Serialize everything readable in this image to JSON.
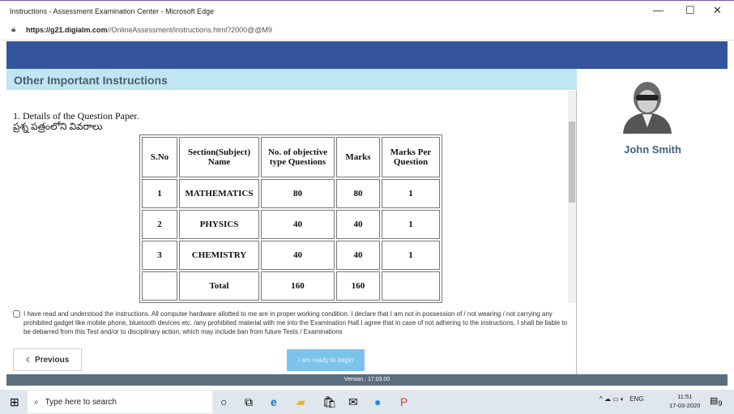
{
  "window": {
    "title": "Instructions - Assessment Examination Center - Microsoft Edge",
    "url_host": "https://g21.digialm.com",
    "url_path": "//OnlineAssessment/instructions.html?2000@@M9"
  },
  "section": {
    "title": "Other Important Instructions"
  },
  "content": {
    "heading": "1. Details of the Question Paper.",
    "heading_telugu": "ప్రశ్న పత్రంలోని వివరాలు"
  },
  "table": {
    "headers": [
      "S.No",
      "Section(Subject) Name",
      "No. of objective type Questions",
      "Marks",
      "Marks Per Question"
    ],
    "rows": [
      [
        "1",
        "MATHEMATICS",
        "80",
        "80",
        "1"
      ],
      [
        "2",
        "PHYSICS",
        "40",
        "40",
        "1"
      ],
      [
        "3",
        "CHEMISTRY",
        "40",
        "40",
        "1"
      ],
      [
        "",
        "Total",
        "160",
        "160",
        ""
      ]
    ]
  },
  "agreement": {
    "text": "I have read and understood the instructions. All computer hardware allotted to me are in proper working condition. I declare that I am not in possession of / not wearing / not carrying any prohibited gadget like mobile phone, bluetooth devices etc. /any prohibited material with me into the Examination Hall.I agree that in case of not adhering to the instructions, I shall be liable to be debarred from this Test and/or to disciplinary action, which may include ban from future Tests / Examinations",
    "checked": false
  },
  "buttons": {
    "previous": "Previous",
    "ready": "I am ready to begin"
  },
  "footer": {
    "version": "Version : 17.03.00"
  },
  "profile": {
    "name": "John Smith"
  },
  "taskbar": {
    "search_placeholder": "Type here to search",
    "language": "ENG",
    "time": "11:51",
    "date": "17-03-2020",
    "notifications": "9"
  },
  "colors": {
    "header_blue": "#34549c",
    "section_bg": "#bfe6f2",
    "ready_button": "#7cc3ec",
    "footer": "#5b6e7e"
  }
}
